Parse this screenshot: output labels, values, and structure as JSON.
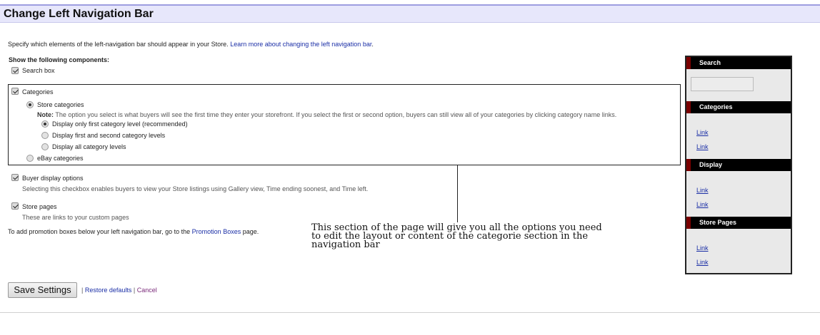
{
  "page": {
    "title": "Change Left Navigation Bar",
    "intro_text": "Specify which elements of the left-navigation bar should appear in your Store. ",
    "intro_link": "Learn more about changing the left navigation bar",
    "intro_end": "."
  },
  "components": {
    "heading": "Show the following components:",
    "search_box": {
      "label": "Search box",
      "checked": true
    },
    "categories": {
      "label": "Categories",
      "checked": true,
      "store_categories": "Store categories",
      "note_label": "Note:",
      "note_text": " The option you select is what buyers will see the first time they enter your storefront. If you select the first or second option, buyers can still view all of your categories by clicking category name links.",
      "level_options": [
        {
          "label": "Display only first category level (recommended)",
          "selected": true
        },
        {
          "label": "Display first and second category levels",
          "selected": false
        },
        {
          "label": "Display all category levels",
          "selected": false
        }
      ],
      "ebay_categories": "eBay categories"
    },
    "buyer_display": {
      "label": "Buyer display options",
      "checked": true,
      "description": "Selecting this checkbox enables buyers to view your Store listings using Gallery view, Time ending soonest, and Time left."
    },
    "store_pages": {
      "label": "Store pages",
      "checked": true,
      "description": "These are links to your custom pages"
    }
  },
  "promotion": {
    "text": "To add promotion boxes below your left navigation bar, go to the ",
    "link": "Promotion Boxes",
    "end": " page."
  },
  "annotation": {
    "line1": "This section of the page will give you all the options you need",
    "line2": "to edit the layout or content of the categorie section in the",
    "line3": "navigation bar"
  },
  "actions": {
    "save": "Save Settings",
    "sep1": "|",
    "restore": "Restore defaults",
    "sep2": "|",
    "cancel": "Cancel"
  },
  "preview": {
    "search_heading": "Search",
    "categories_heading": "Categories",
    "categories_links": [
      "Link",
      "Link"
    ],
    "display_heading": "Display",
    "display_links": [
      "Link",
      "Link"
    ],
    "store_pages_heading": "Store Pages",
    "store_pages_links": [
      "Link",
      "Link"
    ]
  },
  "colors": {
    "header_bg": "#e7e7fb",
    "link": "#1a2ea6",
    "preview_accent": "#7a0000"
  }
}
